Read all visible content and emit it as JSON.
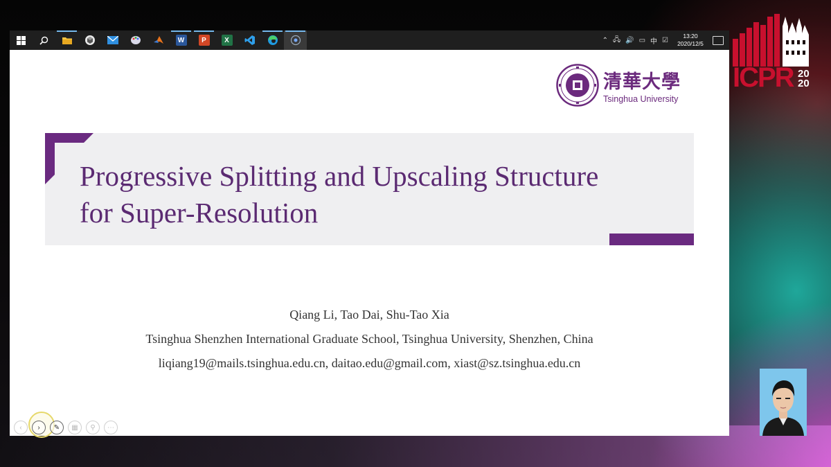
{
  "taskbar": {
    "apps": [
      {
        "name": "start-menu",
        "icon": "windows-icon"
      },
      {
        "name": "search",
        "icon": "search-icon"
      },
      {
        "name": "file-explorer",
        "icon": "folder-icon"
      },
      {
        "name": "app-3d",
        "icon": "cube-icon"
      },
      {
        "name": "mail",
        "icon": "mail-icon"
      },
      {
        "name": "paint",
        "icon": "palette-icon"
      },
      {
        "name": "matlab",
        "icon": "matlab-icon"
      },
      {
        "name": "word",
        "icon": "word-icon",
        "letter": "W"
      },
      {
        "name": "powerpoint",
        "icon": "powerpoint-icon",
        "letter": "P"
      },
      {
        "name": "excel",
        "icon": "excel-icon",
        "letter": "X"
      },
      {
        "name": "vscode",
        "icon": "vscode-icon"
      },
      {
        "name": "edge",
        "icon": "edge-icon"
      },
      {
        "name": "presenter",
        "icon": "record-icon"
      }
    ],
    "tray": {
      "ime": "中",
      "time": "13:20",
      "date": "2020/12/5"
    }
  },
  "slide": {
    "logo": {
      "cn": "清華大學",
      "en": "Tsinghua University"
    },
    "title_line1": "Progressive Splitting and Upscaling Structure",
    "title_line2": "for Super-Resolution",
    "authors": "Qiang Li, Tao Dai, Shu-Tao Xia",
    "affiliation": "Tsinghua Shenzhen International Graduate School, Tsinghua University, Shenzhen, China",
    "emails": "liqiang19@mails.tsinghua.edu.cn, daitao.edu@gmail.com, xiast@sz.tsinghua.edu.cn"
  },
  "conference": {
    "name": "ICPR",
    "year_top": "20",
    "year_bottom": "20",
    "colors": {
      "red": "#c8102e",
      "white": "#ffffff"
    }
  },
  "colors": {
    "accent_purple": "#6a2a80",
    "title_text": "#5b2a72",
    "taskbar": "#1f1f1f"
  }
}
